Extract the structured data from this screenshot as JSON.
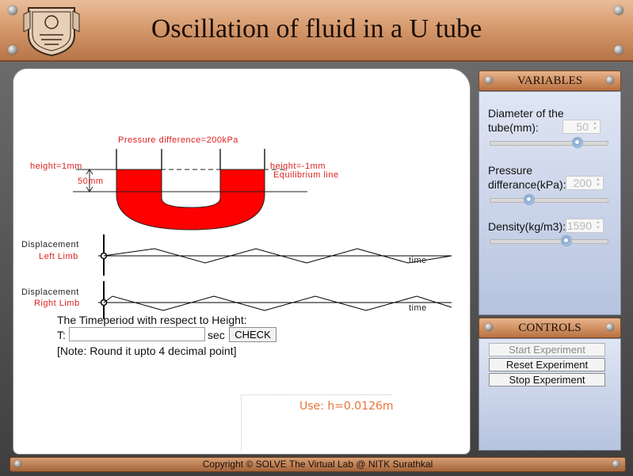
{
  "header": {
    "title": "Oscillation of fluid in a U tube"
  },
  "diagram": {
    "pressure_label": "Pressure difference=200kPa",
    "left_height": "height=1mm",
    "right_height": "height=-1mm",
    "fluid_height": "50mm",
    "equilibrium_label": "Equilibrium line",
    "fluid_color": "#ff0000"
  },
  "graphs": {
    "left": {
      "title": "Displacement",
      "limb": "Left Limb",
      "axis": "time"
    },
    "right": {
      "title": "Displacement",
      "limb": "Right Limb",
      "axis": "time"
    }
  },
  "question": {
    "prompt": "The Timeperiod with respect to Height:",
    "t_label": "T:",
    "unit": "sec",
    "check_label": "CHECK",
    "note": "[Note: Round it upto 4 decimal point]",
    "answer_value": ""
  },
  "hint": "Use: h=0.0126m",
  "variables_panel": {
    "title": "VARIABLES",
    "diameter": {
      "label_1": "Diameter of the",
      "label_2": "tube(mm):",
      "value": "50",
      "slider_fraction": 0.74
    },
    "pressure": {
      "label_1": "Pressure",
      "label_2": "differance(kPa):",
      "value": "200",
      "slider_fraction": 0.33
    },
    "density": {
      "label_1": "Density(kg/m3):",
      "value": "1590",
      "slider_fraction": 0.65
    }
  },
  "controls_panel": {
    "title": "CONTROLS",
    "start_label": "Start Experiment",
    "reset_label": "Reset Experiment",
    "stop_label": "Stop Experiment"
  },
  "footer": {
    "text": "Copyright © SOLVE The Virtual Lab @ NITK Surathkal"
  },
  "colors": {
    "accent_copper": "#c98656",
    "panel_blue": "#c9d3ea",
    "hint_orange": "#e8743a",
    "label_red": "#e02020"
  },
  "icons": {
    "logo": "nitk-crest-icon",
    "screw": "screw-icon"
  }
}
